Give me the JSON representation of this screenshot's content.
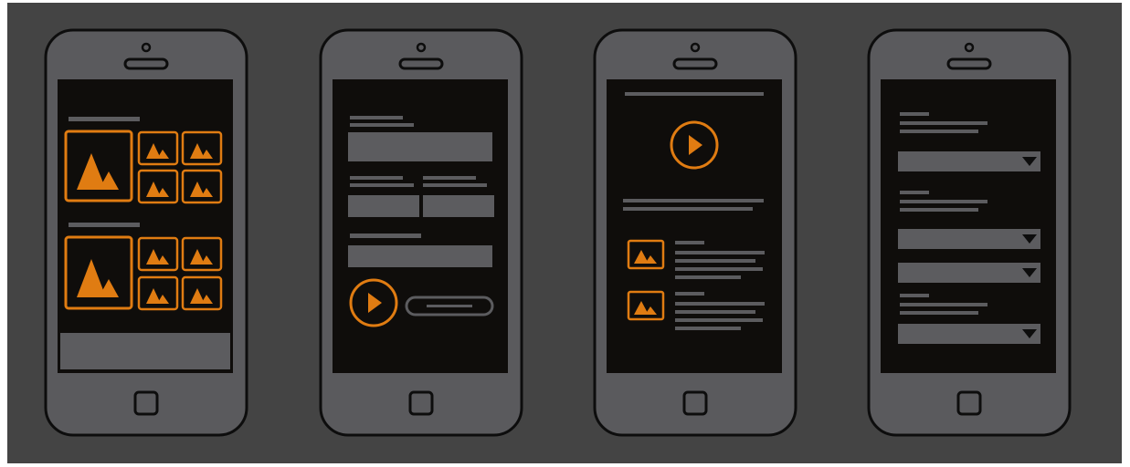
{
  "colors": {
    "background": "#444444",
    "phone_body": "#5a5a5d",
    "outline": "#0d0d0d",
    "screen": "#0f0d0b",
    "placeholder": "#5c5c5f",
    "accent": "#e07c12"
  },
  "phones": [
    {
      "screen": "image-gallery",
      "icons": [
        "image-placeholder-icon",
        "image-placeholder-icon"
      ]
    },
    {
      "screen": "form-with-video",
      "icons": [
        "play-icon"
      ]
    },
    {
      "screen": "video-with-articles",
      "icons": [
        "play-icon",
        "image-placeholder-icon"
      ]
    },
    {
      "screen": "dropdown-form",
      "icons": [
        "dropdown-arrow-icon"
      ]
    }
  ]
}
